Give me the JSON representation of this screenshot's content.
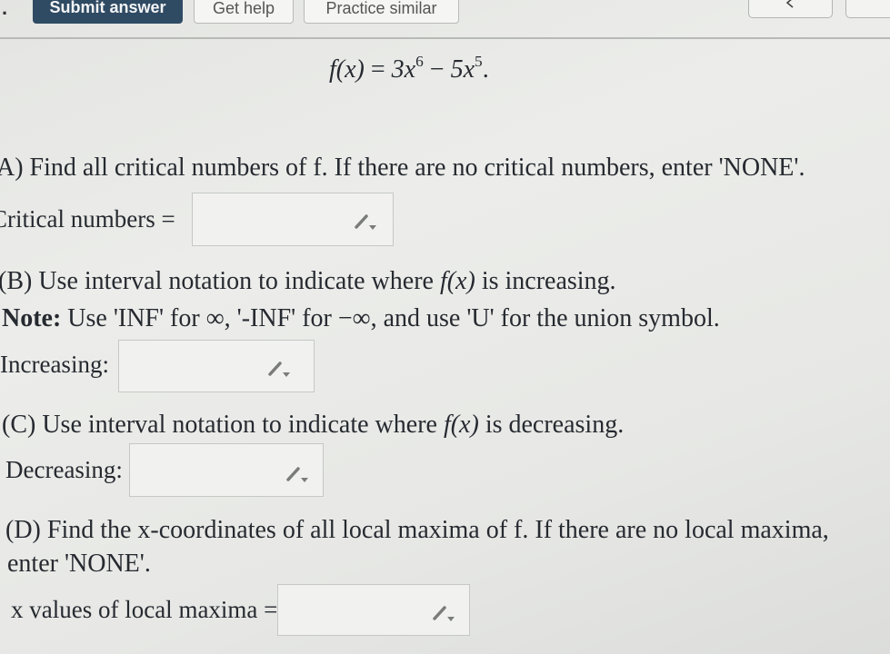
{
  "toolbar": {
    "leading_mark": ".",
    "submit_label": "Submit answer",
    "help_label": "Get help",
    "similar_label": "Practice similar"
  },
  "problem": {
    "function_lhs": "f(x)",
    "equals": " = ",
    "term1_base": "3x",
    "term1_exp": "6",
    "minus": " − ",
    "term2_base": "5x",
    "term2_exp": "5",
    "period": "."
  },
  "part_a": {
    "prompt": "A) Find all critical numbers of f. If there are no critical numbers, enter 'NONE'.",
    "field_label": "Critical numbers ="
  },
  "part_b": {
    "prompt_prefix": "(B) Use interval notation to indicate where ",
    "prompt_fx": "f(x)",
    "prompt_suffix": " is increasing.",
    "note_label": "Note:",
    "note_text": " Use 'INF' for ∞, '-INF' for −∞, and use 'U' for the union symbol.",
    "field_label": "Increasing:"
  },
  "part_c": {
    "prompt_prefix": "(C) Use interval notation to indicate where ",
    "prompt_fx": "f(x)",
    "prompt_suffix": " is decreasing.",
    "field_label": "Decreasing:"
  },
  "part_d": {
    "prompt_line1": "(D) Find the x-coordinates of all local maxima of f. If there are no local maxima,",
    "prompt_line2": "enter 'NONE'.",
    "field_label": "x values of local maxima ="
  },
  "colors": {
    "submit_bg": "#2f4a63",
    "text": "#262a30",
    "pencil": "#7a7c7a"
  }
}
